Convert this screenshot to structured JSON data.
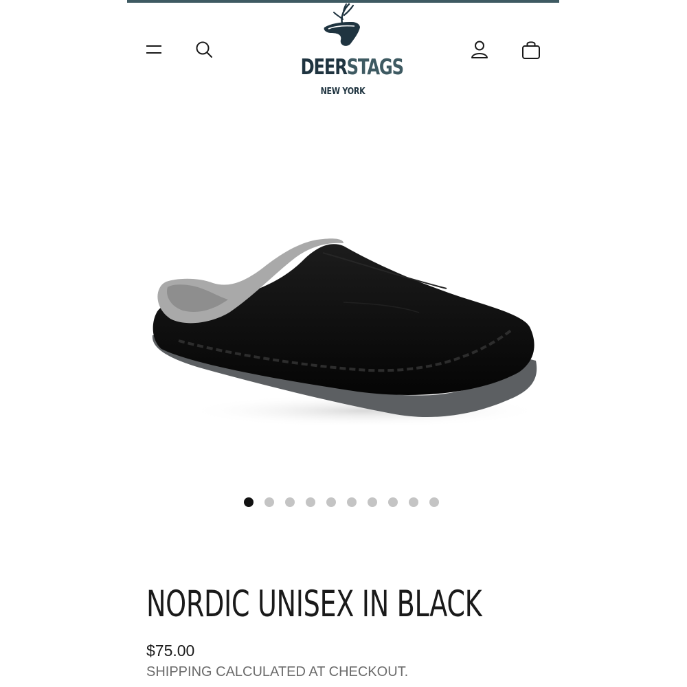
{
  "header": {
    "accent_color": "#3e5a62",
    "icons": {
      "menu": "hamburger-menu-icon",
      "search": "search-icon",
      "account": "user-icon",
      "cart": "shopping-bag-icon"
    },
    "logo": {
      "word_part1": "DEER",
      "word_part2": "STAGS",
      "subtitle": "NEW YORK",
      "brand_color": "#1f3440"
    }
  },
  "gallery": {
    "image_subject": "black slipper with gray fleece lining",
    "slide_count": 10,
    "active_slide": 1
  },
  "product": {
    "title": "NORDIC UNISEX IN BLACK",
    "price": "$75.00",
    "shipping_note": "SHIPPING CALCULATED AT CHECKOUT."
  }
}
